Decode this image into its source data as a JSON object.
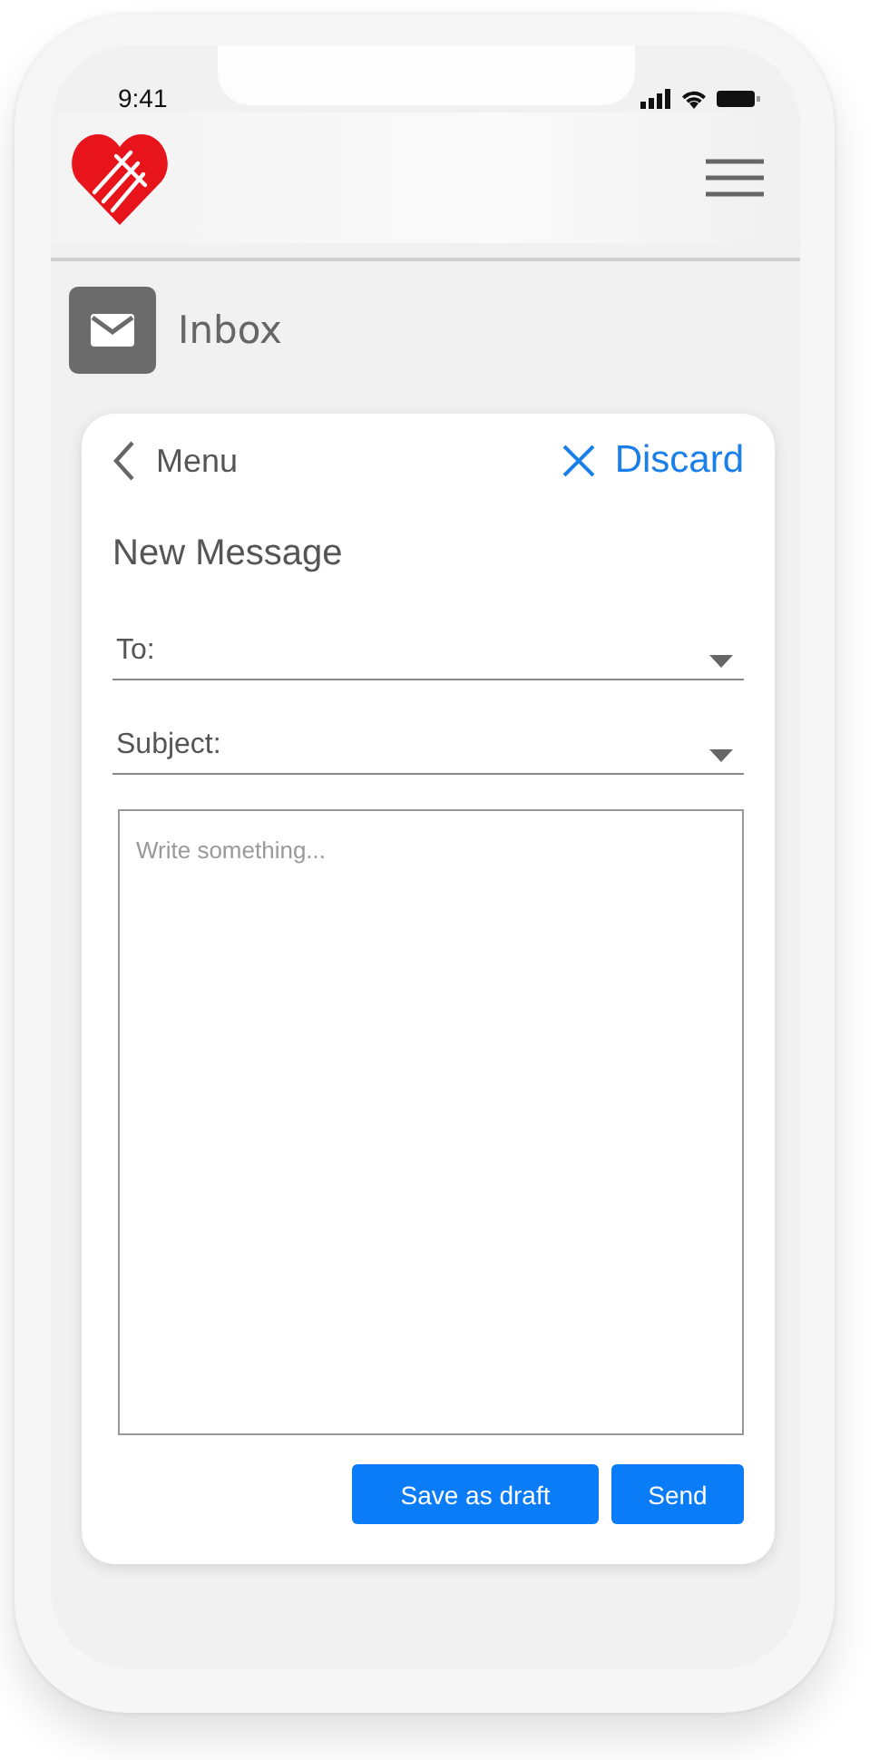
{
  "status_bar": {
    "time": "9:41"
  },
  "section": {
    "title": "Inbox"
  },
  "compose": {
    "back": {
      "label": "Menu"
    },
    "discard": {
      "label": "Discard"
    },
    "title": "New Message",
    "fields": [
      {
        "label": "To:"
      },
      {
        "label": "Subject:"
      }
    ],
    "body": {
      "placeholder": "Write something..."
    },
    "buttons": [
      {
        "label": "Save as draft",
        "kind": "primary"
      },
      {
        "label": "Send",
        "kind": "primary"
      }
    ]
  }
}
